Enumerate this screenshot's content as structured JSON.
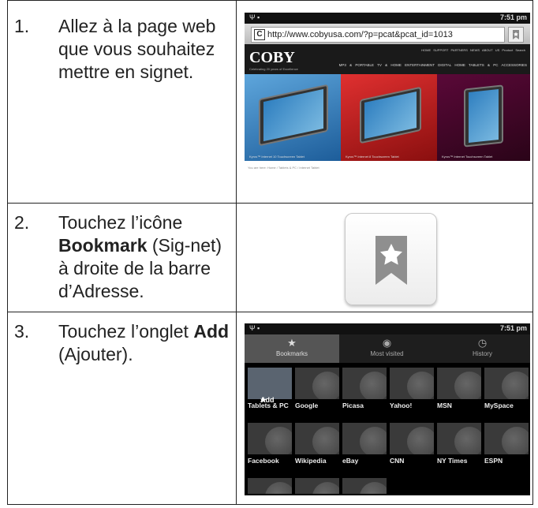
{
  "steps": [
    {
      "number": "1.",
      "text": "Allez à la page web que vous souhaitez mettre en signet."
    },
    {
      "number": "2.",
      "text_before": "Touchez l’icône ",
      "bold": "Bookmark",
      "text_after": " (Sig-net) à droite de la barre d’Adresse."
    },
    {
      "number": "3.",
      "text_before": "Touchez l’onglet ",
      "bold": "Add",
      "text_after": " (Ajouter)."
    }
  ],
  "screenshot1": {
    "time": "7:51 pm",
    "url": "http://www.cobyusa.com/?p=pcat&pcat_id=1013",
    "logo": "COBY",
    "tagline": "Celebrating 20 years of Excellence",
    "top_nav": "HOME SUPPORT PARTNERS NEWS ABOUT US Product Search",
    "main_nav": "MP3 & PORTABLE TV & HOME ENTERTAINMENT DIGITAL HOME TABLETS & PC ACCESSORIES",
    "panels": [
      {
        "caption": "Kyros™ Internet 10 Touchscreen Tablet",
        "color": "#2a74b8"
      },
      {
        "caption": "Kyros™ Internet 8 Touchscreen Tablet",
        "color": "#c01818"
      },
      {
        "caption": "Kyros™ Internet Touchscreen Tablet",
        "color": "#8a1050"
      }
    ],
    "breadcrumb": "You are here: Home / Tablets & PC / Internet Tablet"
  },
  "screenshot3": {
    "time": "7:51 pm",
    "tabs": [
      {
        "label": "Bookmarks",
        "icon": "bookmark-star-icon"
      },
      {
        "label": "Most visited",
        "icon": "eye-icon"
      },
      {
        "label": "History",
        "icon": "clock-icon"
      }
    ],
    "add_label": "Add",
    "bookmarks": [
      "Tablets & PC",
      "Google",
      "Picasa",
      "Yahoo!",
      "MSN",
      "MySpace",
      "Facebook",
      "Wikipedia",
      "eBay",
      "CNN",
      "NY Times",
      "ESPN"
    ]
  }
}
